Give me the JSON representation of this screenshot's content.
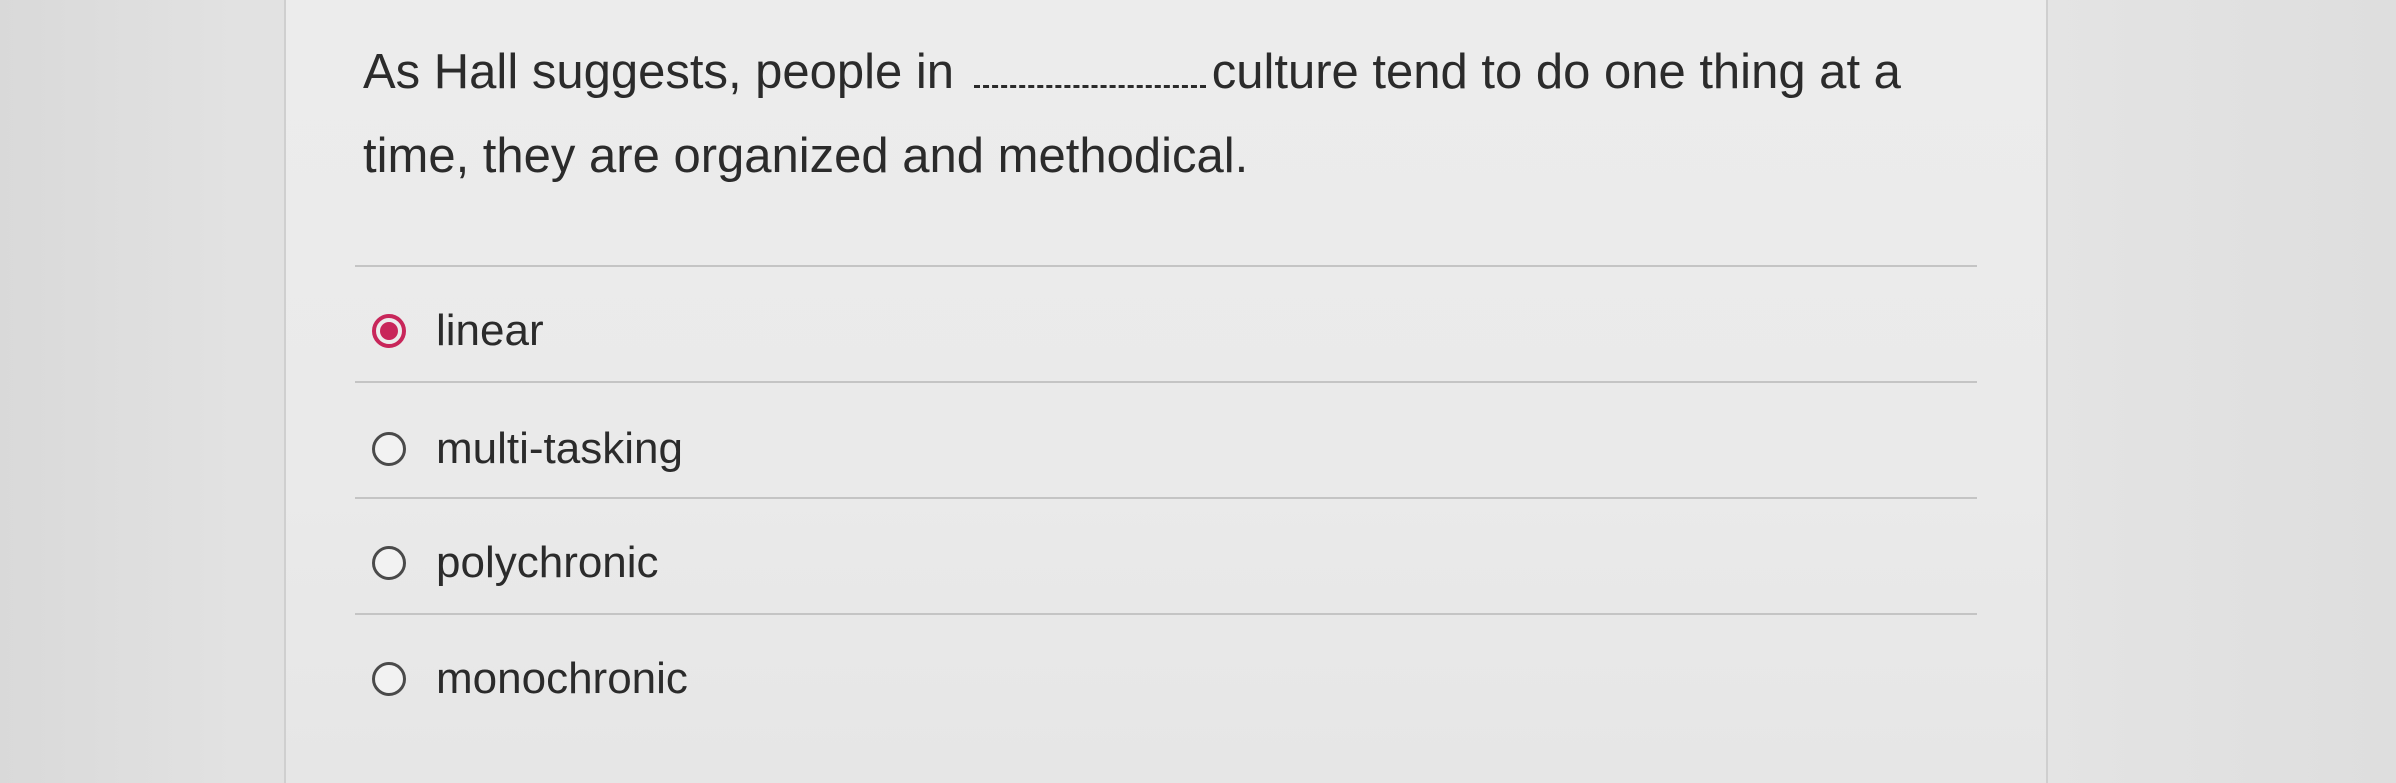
{
  "question": {
    "text_before_blank": "As Hall suggests, people in",
    "blank": "",
    "text_after_blank": "culture tend to do one thing at a time, they are organized and methodical."
  },
  "options": [
    {
      "label": "linear",
      "selected": true
    },
    {
      "label": "multi-tasking",
      "selected": false
    },
    {
      "label": "polychronic",
      "selected": false
    },
    {
      "label": "monochronic",
      "selected": false
    }
  ],
  "colors": {
    "selected_accent": "#c8265a",
    "text": "#2b2b2b"
  }
}
